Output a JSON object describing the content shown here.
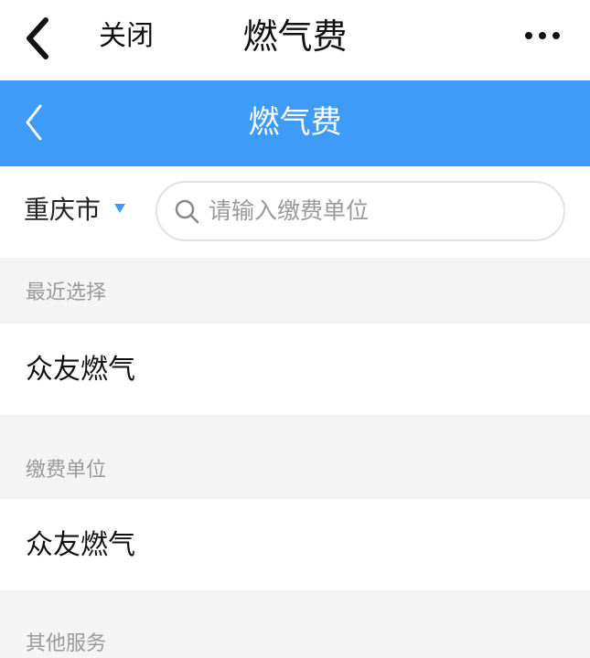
{
  "topbar": {
    "back_icon": "chevron-left-icon",
    "close_label": "关闭",
    "title": "燃气费",
    "more_icon": "more-horizontal-icon"
  },
  "header": {
    "back_icon": "chevron-left-icon",
    "title": "燃气费",
    "color": "#3e9bf7"
  },
  "filter": {
    "city": "重庆市",
    "city_caret_icon": "caret-down-icon",
    "search_icon": "search-icon",
    "search_placeholder": "请输入缴费单位"
  },
  "sections": [
    {
      "title": "最近选择",
      "items": [
        "众友燃气"
      ]
    },
    {
      "title": "缴费单位",
      "items": [
        "众友燃气"
      ]
    },
    {
      "title": "其他服务",
      "items": []
    }
  ]
}
